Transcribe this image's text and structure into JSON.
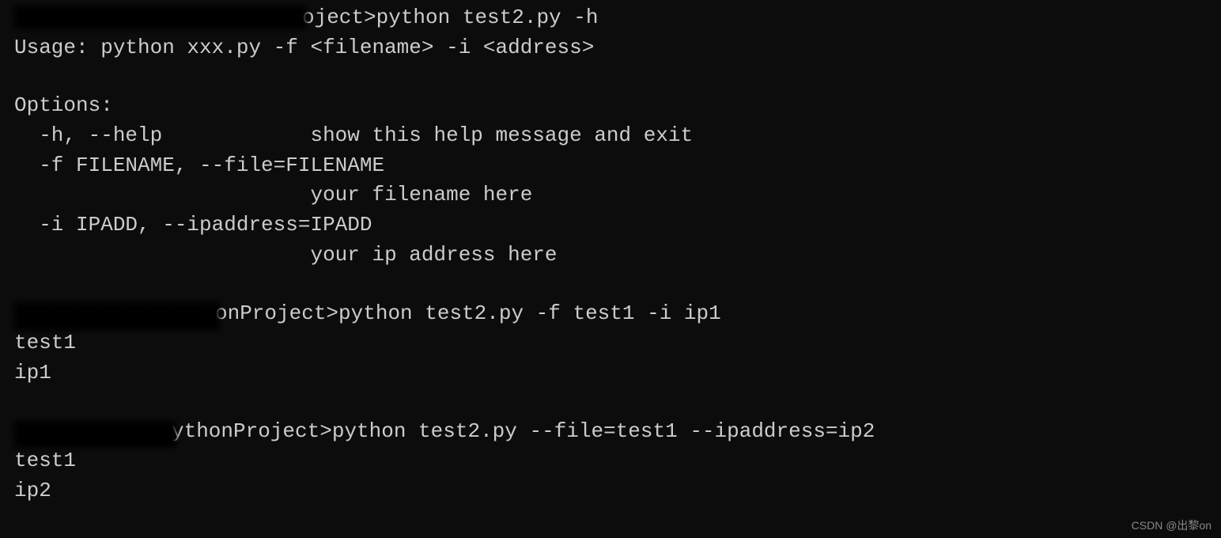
{
  "block1": {
    "prompt_suffix": "oject>",
    "command": "python test2.py -h",
    "usage": "Usage: python xxx.py -f <filename> -i <address>",
    "options_header": "Options:",
    "opt_help": "  -h, --help            show this help message and exit",
    "opt_file_flag": "  -f FILENAME, --file=FILENAME",
    "opt_file_desc": "                        your filename here",
    "opt_ip_flag": "  -i IPADD, --ipaddress=IPADD",
    "opt_ip_desc": "                        your ip address here"
  },
  "block2": {
    "prompt_suffix": "onProject>",
    "command": "python test2.py -f test1 -i ip1",
    "out1": "test1",
    "out2": "ip1"
  },
  "block3": {
    "prompt_suffix": "ythonProject>",
    "command": "python test2.py --file=test1 --ipaddress=ip2",
    "out1": "test1",
    "out2": "ip2"
  },
  "watermark": "CSDN @出黎on"
}
